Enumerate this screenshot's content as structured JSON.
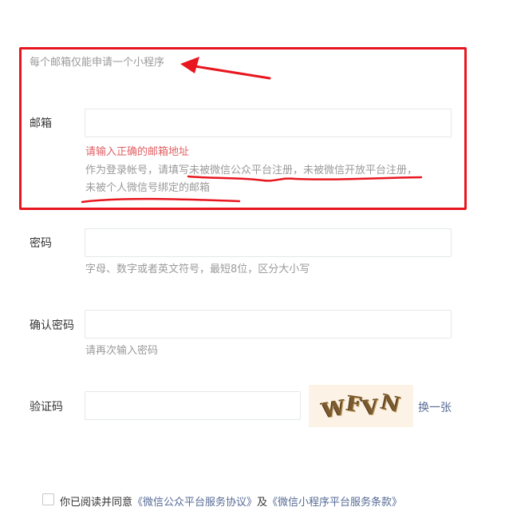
{
  "form": {
    "email_limit_note": "每个邮箱仅能申请一个小程序",
    "email": {
      "label": "邮箱",
      "value": "",
      "placeholder": "",
      "error": "请输入正确的邮箱地址",
      "description_line1": "作为登录帐号，请填写未被微信公众平台注册，未被微信开放平台注册，",
      "description_line2": "未被个人微信号绑定的邮箱"
    },
    "password": {
      "label": "密码",
      "value": "",
      "placeholder": "",
      "hint": "字母、数字或者英文符号，最短8位，区分大小写"
    },
    "confirm_password": {
      "label": "确认密码",
      "value": "",
      "placeholder": "",
      "hint": "请再次输入密码"
    },
    "captcha": {
      "label": "验证码",
      "value": "",
      "placeholder": "",
      "image_text": [
        "W",
        "F",
        "V",
        "N"
      ],
      "refresh_label": "换一张"
    },
    "agreement": {
      "checked": false,
      "prefix": "你已阅读并同意",
      "link1": "《微信公众平台服务协议》",
      "middle": "及",
      "link2": "《微信小程序平台服务条款》"
    }
  },
  "annotations": {
    "color": "#e8161f"
  },
  "colors": {
    "link": "#576b95",
    "error": "#e15f63",
    "hint": "#9a9a9a"
  }
}
